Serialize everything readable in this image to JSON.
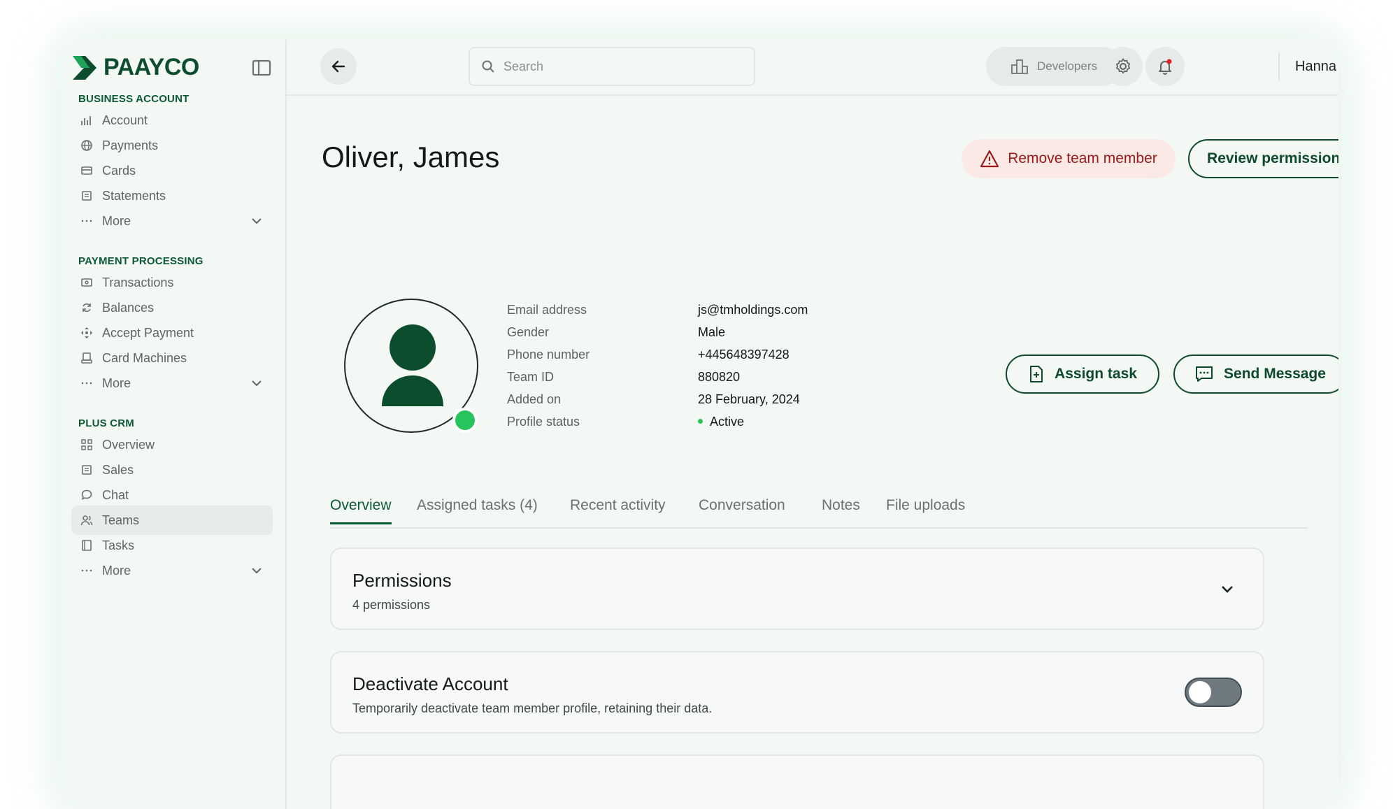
{
  "brand": {
    "name": "PAAYCO",
    "color": "#0b4d2c"
  },
  "sidebar": {
    "sections": [
      {
        "title": "BUSINESS ACCOUNT",
        "items": [
          {
            "label": "Account",
            "icon": "bar-chart-icon"
          },
          {
            "label": "Payments",
            "icon": "globe-icon"
          },
          {
            "label": "Cards",
            "icon": "card-icon"
          },
          {
            "label": "Statements",
            "icon": "document-icon"
          },
          {
            "label": "More",
            "icon": "dots-icon"
          }
        ]
      },
      {
        "title": "PAYMENT PROCESSING",
        "items": [
          {
            "label": "Transactions",
            "icon": "cash-icon"
          },
          {
            "label": "Balances",
            "icon": "refresh-icon"
          },
          {
            "label": "Accept Payment",
            "icon": "move-icon"
          },
          {
            "label": "Card Machines",
            "icon": "terminal-icon"
          },
          {
            "label": "More",
            "icon": "dots-icon"
          }
        ]
      },
      {
        "title": "PLUS CRM",
        "items": [
          {
            "label": "Overview",
            "icon": "grid-icon"
          },
          {
            "label": "Sales",
            "icon": "document-icon"
          },
          {
            "label": "Chat",
            "icon": "chat-icon"
          },
          {
            "label": "Teams",
            "icon": "users-icon",
            "active": true
          },
          {
            "label": "Tasks",
            "icon": "book-icon"
          },
          {
            "label": "More",
            "icon": "dots-icon"
          }
        ]
      }
    ]
  },
  "topbar": {
    "search_placeholder": "Search",
    "developers_label": "Developers",
    "user_name": "Hanna",
    "notification_dot_color": "#e02424"
  },
  "profile": {
    "name": "Oliver, James",
    "remove_label": "Remove team member",
    "review_label": "Review permissions",
    "assign_label": "Assign task",
    "message_label": "Send Message",
    "fields": [
      {
        "label": "Email address",
        "value": "js@tmholdings.com"
      },
      {
        "label": "Gender",
        "value": "Male"
      },
      {
        "label": "Phone number",
        "value": "+445648397428"
      },
      {
        "label": "Team ID",
        "value": "880820"
      },
      {
        "label": "Added on",
        "value": "28 February, 2024"
      },
      {
        "label": "Profile status",
        "value": "Active"
      }
    ],
    "status_color": "#27c45c"
  },
  "tabs": [
    "Overview",
    "Assigned tasks (4)",
    "Recent activity",
    "Conversation",
    "Notes",
    "File uploads"
  ],
  "active_tab": "Overview",
  "cards": {
    "permissions": {
      "title": "Permissions",
      "subtitle": "4 permissions"
    },
    "deactivate": {
      "title": "Deactivate Account",
      "subtitle": "Temporarily deactivate team member profile, retaining their data.",
      "enabled": false
    }
  }
}
